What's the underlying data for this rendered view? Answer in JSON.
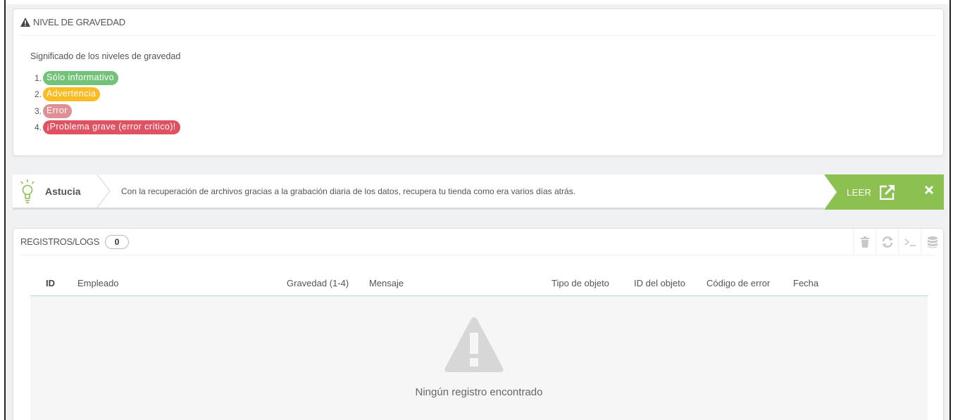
{
  "severity": {
    "title": "NIVEL DE GRAVEDAD",
    "intro": "Significado de los niveles de gravedad",
    "levels": [
      {
        "num": "1.",
        "label": "Sólo informativo",
        "color": "#72c279"
      },
      {
        "num": "2.",
        "label": "Advertencia",
        "color": "#fbbb22"
      },
      {
        "num": "3.",
        "label": "Error",
        "color": "#e08f95"
      },
      {
        "num": "4.",
        "label": "¡Problema grave (error crítico)!",
        "color": "#e05262"
      }
    ]
  },
  "tip": {
    "title": "Astucia",
    "text": "Con la recuperación de archivos gracias a la grabación diaria de los datos, recupera tu tienda como era varios días atrás.",
    "read_label": "LEER",
    "accent": "#8cc152"
  },
  "logs": {
    "title": "REGISTROS/LOGS",
    "count": "0",
    "tools": [
      "trash-icon",
      "refresh-icon",
      "terminal-icon",
      "database-icon"
    ],
    "columns": [
      "ID",
      "Empleado",
      "Gravedad (1-4)",
      "Mensaje",
      "Tipo de objeto",
      "ID del objeto",
      "Código de error",
      "Fecha"
    ],
    "empty_text": "Ningún registro encontrado"
  }
}
